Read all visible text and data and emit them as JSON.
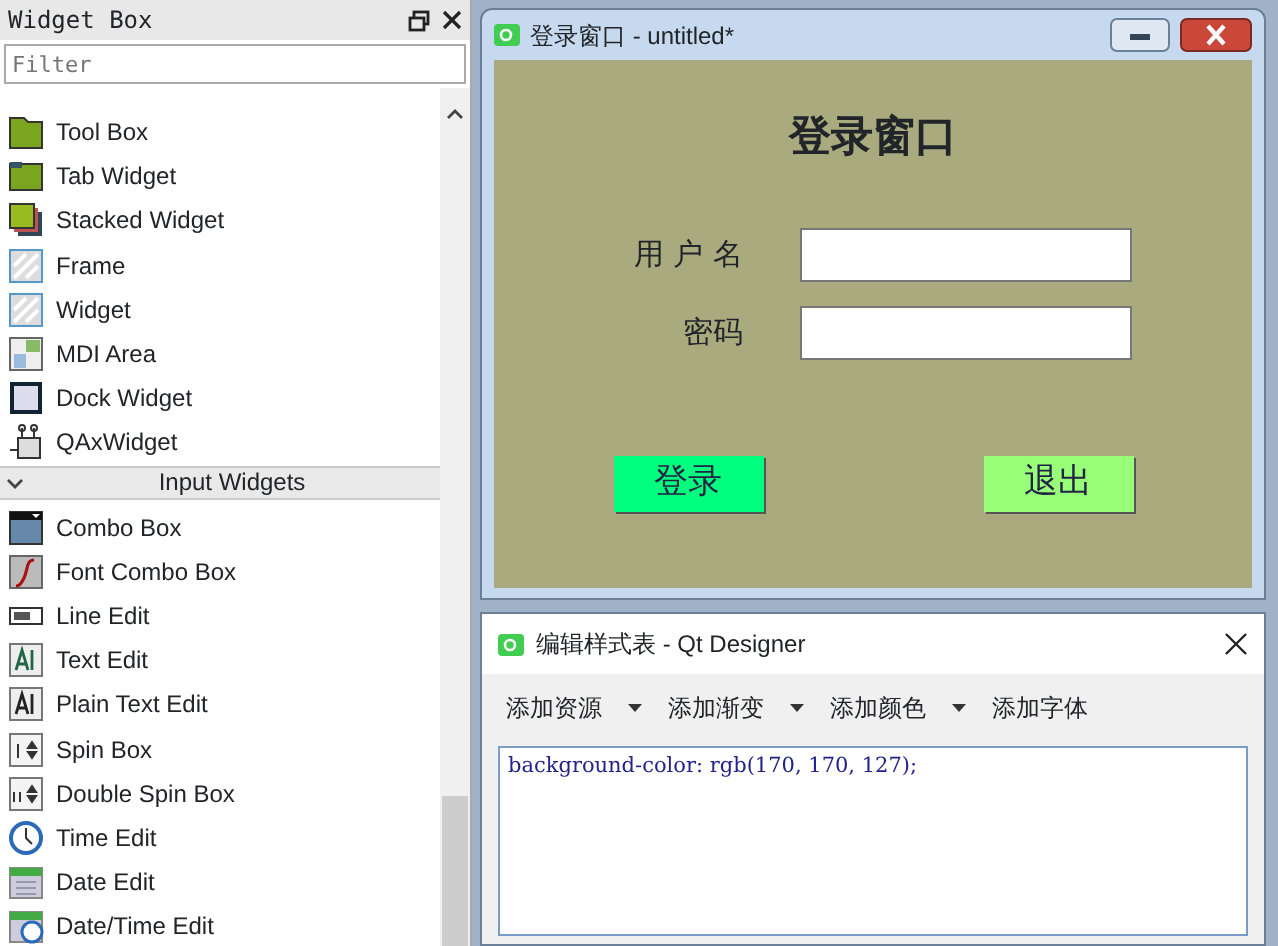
{
  "widget_box": {
    "title": "Widget Box",
    "filter": {
      "placeholder": "Filter"
    },
    "list": [
      {
        "kind": "item",
        "label": "Tool Box"
      },
      {
        "kind": "item",
        "label": "Tab Widget"
      },
      {
        "kind": "item",
        "label": "Stacked Widget"
      },
      {
        "kind": "item",
        "label": "Frame"
      },
      {
        "kind": "item",
        "label": "Widget"
      },
      {
        "kind": "item",
        "label": "MDI Area"
      },
      {
        "kind": "item",
        "label": "Dock Widget"
      },
      {
        "kind": "item",
        "label": "QAxWidget"
      },
      {
        "kind": "category",
        "label": "Input Widgets",
        "expanded": true
      },
      {
        "kind": "item",
        "label": "Combo Box"
      },
      {
        "kind": "item",
        "label": "Font Combo Box"
      },
      {
        "kind": "item",
        "label": "Line Edit"
      },
      {
        "kind": "item",
        "label": "Text Edit"
      },
      {
        "kind": "item",
        "label": "Plain Text Edit"
      },
      {
        "kind": "item",
        "label": "Spin Box"
      },
      {
        "kind": "item",
        "label": "Double Spin Box"
      },
      {
        "kind": "item",
        "label": "Time Edit"
      },
      {
        "kind": "item",
        "label": "Date Edit"
      },
      {
        "kind": "item",
        "label": "Date/Time Edit"
      }
    ]
  },
  "login_window": {
    "title": "登录窗口 - untitled*",
    "heading": "登录窗口",
    "fields": [
      {
        "label": "用 户 名"
      },
      {
        "label": "密码"
      }
    ],
    "buttons": [
      {
        "label": "登录",
        "color": "#00ff7f"
      },
      {
        "label": "退出",
        "color": "#98ff78"
      }
    ]
  },
  "stylesheet_dialog": {
    "title": "编辑样式表 - Qt Designer",
    "toolbar": [
      {
        "label": "添加资源",
        "dropdown": true
      },
      {
        "label": "添加渐变",
        "dropdown": true
      },
      {
        "label": "添加颜色",
        "dropdown": true
      },
      {
        "label": "添加字体",
        "dropdown": false
      }
    ],
    "editor_text": "background-color: rgb(170, 170, 127);"
  }
}
